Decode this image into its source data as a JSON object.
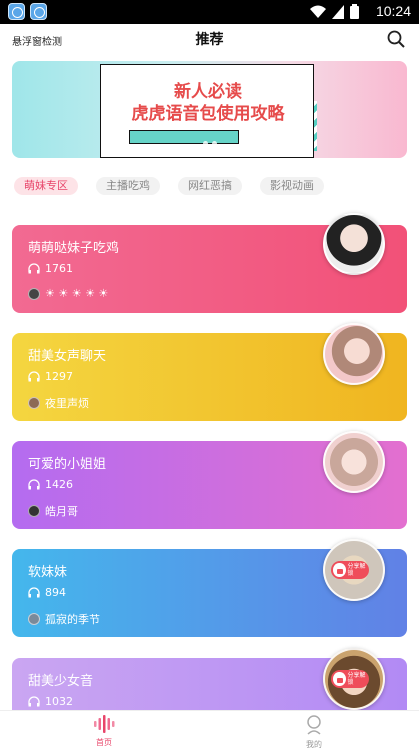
{
  "status": {
    "time": "10:24"
  },
  "header": {
    "left_label": "悬浮窗检测",
    "title": "推荐"
  },
  "banner": {
    "line1": "新人必读",
    "line2": "虎虎语音包使用攻略"
  },
  "tabs": [
    {
      "label": "萌妹专区",
      "active": true
    },
    {
      "label": "主播吃鸡",
      "active": false
    },
    {
      "label": "网红恶搞",
      "active": false
    },
    {
      "label": "影视动画",
      "active": false
    }
  ],
  "cards": [
    {
      "name": "萌萌哒妹子吃鸡",
      "plays": "1761",
      "author": "☀ ☀ ☀ ☀ ☀",
      "locked": false,
      "gradient": [
        "#f0648f",
        "#f6537b"
      ]
    },
    {
      "name": "甜美女声聊天",
      "plays": "1297",
      "author": "夜里声烦",
      "locked": false,
      "gradient": [
        "#f4d33b",
        "#f0b923"
      ]
    },
    {
      "name": "可爱的小姐姐",
      "plays": "1426",
      "author": "皓月哥",
      "locked": false,
      "gradient": [
        "#b46af0",
        "#e06dd0"
      ]
    },
    {
      "name": "软妹妹",
      "plays": "894",
      "author": "孤寂的季节",
      "locked": true,
      "lock_text": "分享解锁",
      "gradient": [
        "#45b6ec",
        "#5f86e6"
      ]
    },
    {
      "name": "甜美少女音",
      "plays": "1032",
      "author": "",
      "locked": true,
      "lock_text": "分享解锁",
      "gradient": [
        "#c9a3f2",
        "#b48af4"
      ]
    }
  ],
  "bottomnav": [
    {
      "label": "首页",
      "active": true
    },
    {
      "label": "我的",
      "active": false
    }
  ],
  "colors": {
    "accent": "#e8456a"
  }
}
